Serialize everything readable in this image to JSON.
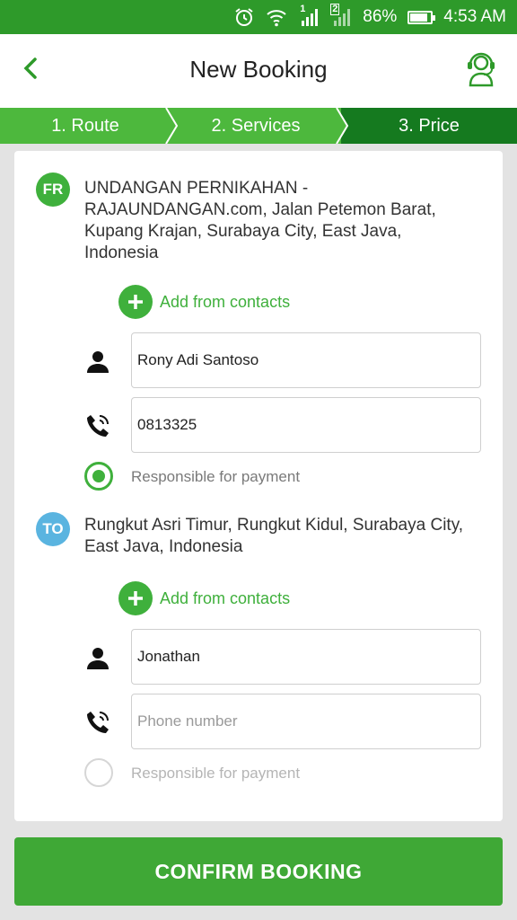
{
  "status_bar": {
    "sim1_label": "1",
    "sim2_label": "2",
    "battery_percent": "86%",
    "battery_level": 0.86,
    "time": "4:53 AM",
    "icons": [
      "alarm-icon",
      "wifi-icon",
      "signal-icon",
      "signal-icon",
      "battery-icon"
    ]
  },
  "header": {
    "title": "New Booking",
    "back_icon": "chevron-left-icon",
    "support_icon": "headset-agent-icon"
  },
  "stepper": {
    "steps": [
      {
        "label": "1. Route",
        "active": false
      },
      {
        "label": "2. Services",
        "active": false
      },
      {
        "label": "3. Price",
        "active": true
      }
    ]
  },
  "origin": {
    "badge": "FR",
    "address": "UNDANGAN PERNIKAHAN - RAJAUNDANGAN.com, Jalan Petemon Barat, Kupang Krajan, Surabaya City, East Java, Indonesia",
    "add_from_contacts": "Add from contacts",
    "name_value": "Rony Adi Santoso",
    "phone_value": "0813325",
    "responsible_label": "Responsible for payment",
    "responsible_checked": true
  },
  "destination": {
    "badge": "TO",
    "address": "Rungkut Asri Timur, Rungkut Kidul, Surabaya City, East Java, Indonesia",
    "add_from_contacts": "Add from contacts",
    "name_value": "Jonathan",
    "phone_placeholder": "Phone number",
    "responsible_label": "Responsible for payment",
    "responsible_checked": false
  },
  "confirm_button": "CONFIRM BOOKING",
  "colors": {
    "status_bar": "#2e9a2a",
    "step_inactive": "#4db83d",
    "step_active": "#157a1f",
    "accent": "#3fb03c",
    "to_badge": "#5ab4e0",
    "confirm": "#3fa836"
  }
}
